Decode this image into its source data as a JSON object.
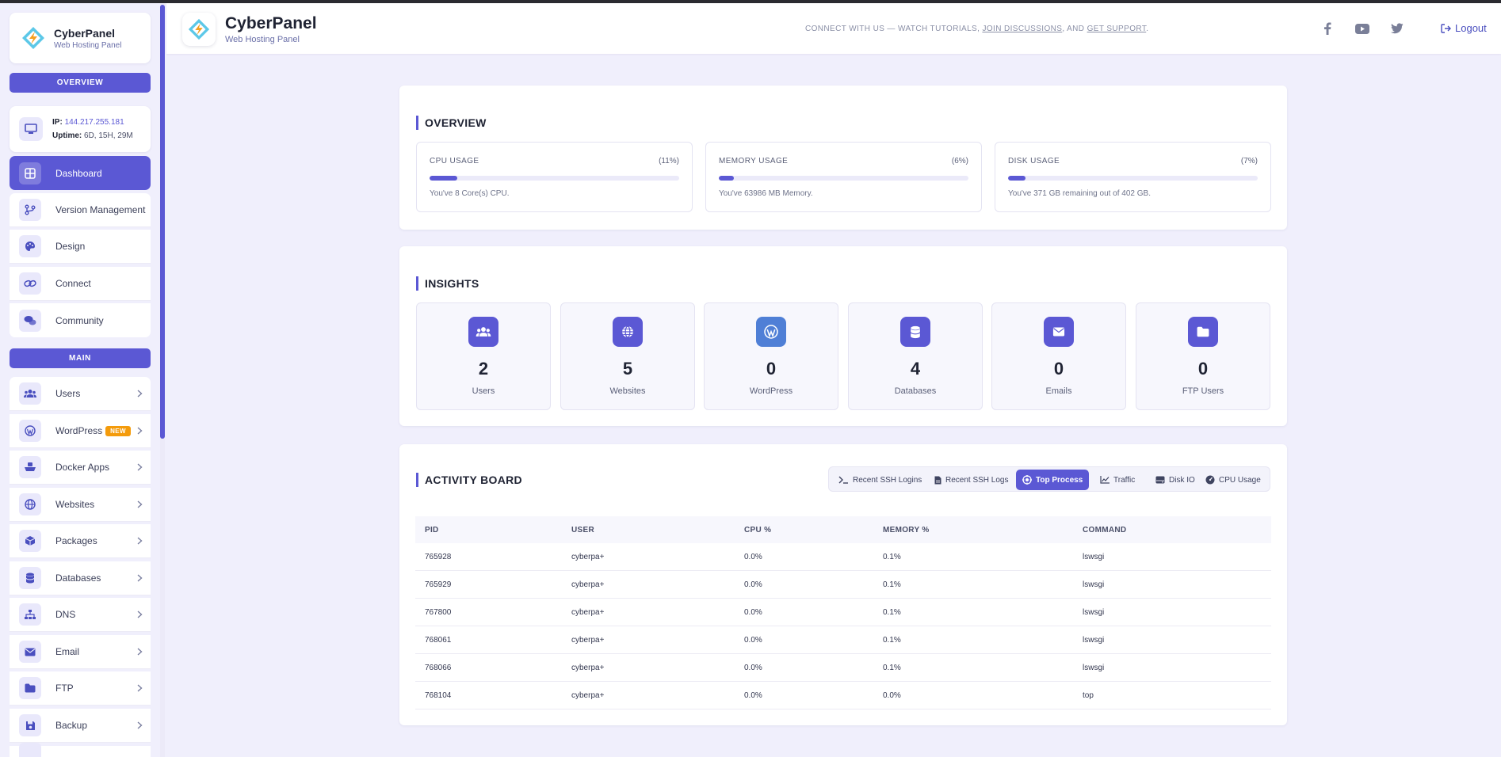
{
  "brand": {
    "name": "CyberPanel",
    "subtitle": "Web Hosting Panel"
  },
  "sidebar": {
    "overview_label": "OVERVIEW",
    "main_label": "MAIN",
    "server": {
      "ip_label": "IP:",
      "ip": "144.217.255.181",
      "uptime_label": "Uptime:",
      "uptime": "6D, 15H, 29M"
    },
    "overview_items": [
      {
        "label": "Dashboard",
        "icon": "dashboard-icon",
        "active": true
      },
      {
        "label": "Version Management",
        "icon": "branch-icon"
      },
      {
        "label": "Design",
        "icon": "palette-icon"
      },
      {
        "label": "Connect",
        "icon": "link-icon"
      },
      {
        "label": "Community",
        "icon": "comments-icon"
      }
    ],
    "main_items": [
      {
        "label": "Users",
        "icon": "users-icon"
      },
      {
        "label": "WordPress",
        "icon": "wordpress-icon",
        "badge": "NEW"
      },
      {
        "label": "Docker Apps",
        "icon": "docker-icon"
      },
      {
        "label": "Websites",
        "icon": "globe-icon"
      },
      {
        "label": "Packages",
        "icon": "package-icon"
      },
      {
        "label": "Databases",
        "icon": "database-icon"
      },
      {
        "label": "DNS",
        "icon": "sitemap-icon"
      },
      {
        "label": "Email",
        "icon": "envelope-icon"
      },
      {
        "label": "FTP",
        "icon": "folder-icon"
      },
      {
        "label": "Backup",
        "icon": "save-icon"
      }
    ]
  },
  "header": {
    "title": "CyberPanel",
    "subtitle": "Web Hosting Panel",
    "connect_prefix": "CONNECT WITH US — WATCH TUTORIALS, ",
    "join_link": "JOIN DISCUSSIONS",
    "connect_mid": ", AND ",
    "support_link": "GET SUPPORT",
    "connect_suffix": ".",
    "logout": "Logout"
  },
  "overview": {
    "title": "OVERVIEW",
    "cpu": {
      "label": "CPU USAGE",
      "pct": "(11%)",
      "value": 11,
      "desc": "You've 8 Core(s) CPU."
    },
    "memory": {
      "label": "MEMORY USAGE",
      "pct": "(6%)",
      "value": 6,
      "desc": "You've 63986 MB Memory."
    },
    "disk": {
      "label": "DISK USAGE",
      "pct": "(7%)",
      "value": 7,
      "desc": "You've 371 GB remaining out of 402 GB."
    }
  },
  "insights": {
    "title": "INSIGHTS",
    "items": [
      {
        "num": "2",
        "label": "Users",
        "icon": "users-icon"
      },
      {
        "num": "5",
        "label": "Websites",
        "icon": "globe-icon"
      },
      {
        "num": "0",
        "label": "WordPress",
        "icon": "wordpress-icon"
      },
      {
        "num": "4",
        "label": "Databases",
        "icon": "database-icon"
      },
      {
        "num": "0",
        "label": "Emails",
        "icon": "envelope-icon"
      },
      {
        "num": "0",
        "label": "FTP Users",
        "icon": "folder-icon"
      }
    ]
  },
  "activity": {
    "title": "ACTIVITY BOARD",
    "tabs": [
      {
        "label": "Recent SSH Logins",
        "icon": "terminal-icon"
      },
      {
        "label": "Recent SSH Logs",
        "icon": "file-icon"
      },
      {
        "label": "Top Process",
        "icon": "cog-icon",
        "active": true
      },
      {
        "label": "Traffic",
        "icon": "chart-line-icon"
      },
      {
        "label": "Disk IO",
        "icon": "hdd-icon"
      },
      {
        "label": "CPU Usage",
        "icon": "gauge-icon"
      }
    ],
    "columns": [
      "PID",
      "USER",
      "CPU %",
      "MEMORY %",
      "COMMAND"
    ],
    "rows": [
      [
        "765928",
        "cyberpa+",
        "0.0%",
        "0.1%",
        "lswsgi"
      ],
      [
        "765929",
        "cyberpa+",
        "0.0%",
        "0.1%",
        "lswsgi"
      ],
      [
        "767800",
        "cyberpa+",
        "0.0%",
        "0.1%",
        "lswsgi"
      ],
      [
        "768061",
        "cyberpa+",
        "0.0%",
        "0.1%",
        "lswsgi"
      ],
      [
        "768066",
        "cyberpa+",
        "0.0%",
        "0.1%",
        "lswsgi"
      ],
      [
        "768104",
        "cyberpa+",
        "0.0%",
        "0.0%",
        "top"
      ]
    ]
  },
  "colors": {
    "accent": "#5b58d4",
    "badge": "#f49b0b",
    "background": "#f0effc"
  }
}
